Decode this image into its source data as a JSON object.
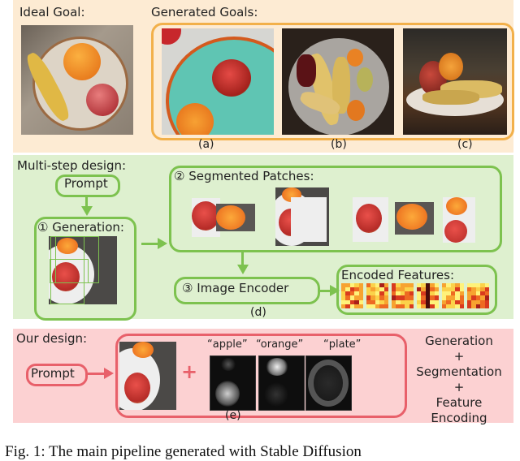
{
  "top_panel": {
    "ideal_goal_label": "Ideal Goal:",
    "generated_goals_label": "Generated Goals:",
    "subfigure_labels": [
      "(a)",
      "(b)",
      "(c)"
    ],
    "colors": {
      "background": "#fdebd3",
      "border": "#f2b04a"
    }
  },
  "multi_step_panel": {
    "title": "Multi-step design:",
    "prompt_label": "Prompt",
    "generation_label": "① Generation:",
    "segmented_label": "② Segmented Patches:",
    "encoder_label": "③ Image Encoder",
    "encoded_label": "Encoded Features:",
    "subfigure_label": "(d)",
    "patch_count": 6,
    "feature_count": 6,
    "colors": {
      "background": "#def0cf",
      "border": "#7dc24f"
    }
  },
  "our_panel": {
    "title": "Our design:",
    "prompt_label": "Prompt",
    "plus_sign": "+",
    "mask_labels": [
      "“apple”",
      "“orange”",
      "“plate”"
    ],
    "summary": [
      "Generation",
      "+",
      "Segmentation",
      "+",
      "Feature Encoding"
    ],
    "subfigure_label": "(e)",
    "colors": {
      "background": "#fcd1d2",
      "border": "#e8606a"
    }
  },
  "caption": "Fig. 1: The main pipeline generated with Stable Diffusion"
}
